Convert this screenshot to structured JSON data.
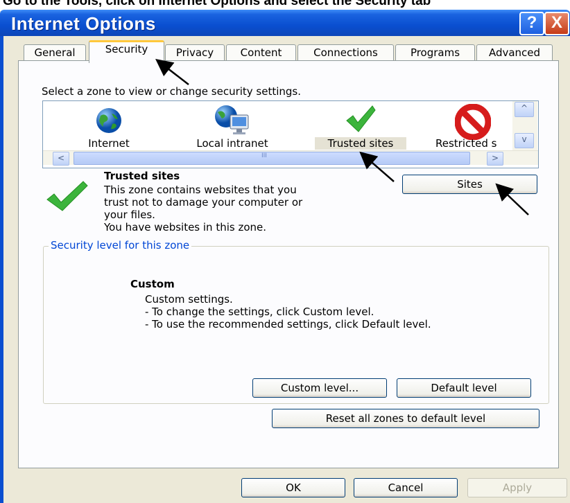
{
  "top_caption": "Go to the Tools, click on Internet Options and select the Security tab",
  "window": {
    "title": "Internet Options",
    "help_button": "?",
    "close_button": "X"
  },
  "tabs": [
    {
      "label": "General"
    },
    {
      "label": "Security"
    },
    {
      "label": "Privacy"
    },
    {
      "label": "Content"
    },
    {
      "label": "Connections"
    },
    {
      "label": "Programs"
    },
    {
      "label": "Advanced"
    }
  ],
  "zone_prompt": "Select a zone to view or change security settings.",
  "zones": [
    {
      "label": "Internet",
      "icon": "globe-icon"
    },
    {
      "label": "Local intranet",
      "icon": "intranet-icon"
    },
    {
      "label": "Trusted sites",
      "icon": "checkmark-icon",
      "selected": true
    },
    {
      "label": "Restricted s",
      "icon": "restricted-icon"
    }
  ],
  "scroll": {
    "left": "<",
    "right": ">",
    "up": "^",
    "down": "v",
    "grip": "III"
  },
  "selected_zone": {
    "title": "Trusted sites",
    "desc_lines": [
      "This zone contains websites that you",
      "trust not to damage your computer or",
      "your files.",
      "You have websites in this zone."
    ],
    "sites_button": "Sites"
  },
  "security_level": {
    "legend": "Security level for this zone",
    "level_name": "Custom",
    "lines": [
      "Custom settings.",
      "- To change the settings, click Custom level.",
      "- To use the recommended settings, click Default level."
    ],
    "custom_button": "Custom level...",
    "default_button": "Default level"
  },
  "reset_button": "Reset all zones to default level",
  "footer": {
    "ok": "OK",
    "cancel": "Cancel",
    "apply": "Apply"
  },
  "colors": {
    "titlebar": "#0a4fd0",
    "accent_tab": "#ffc83c",
    "legend": "#0046d5"
  }
}
